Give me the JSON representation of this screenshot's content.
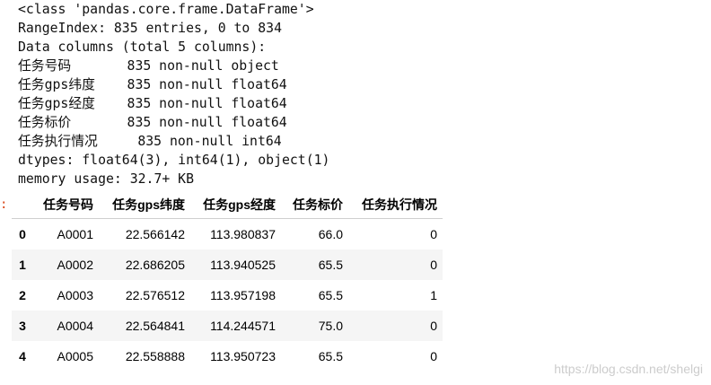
{
  "info_output": {
    "lines": [
      "<class 'pandas.core.frame.DataFrame'>",
      "RangeIndex: 835 entries, 0 to 834",
      "Data columns (total 5 columns):",
      "任务号码       835 non-null object",
      "任务gps纬度    835 non-null float64",
      "任务gps经度    835 non-null float64",
      "任务标价       835 non-null float64",
      "任务执行情况     835 non-null int64",
      "dtypes: float64(3), int64(1), object(1)",
      "memory usage: 32.7+ KB"
    ]
  },
  "out_prompt": ":",
  "dataframe": {
    "columns": [
      "任务号码",
      "任务gps纬度",
      "任务gps经度",
      "任务标价",
      "任务执行情况"
    ],
    "rows": [
      {
        "index": "0",
        "cells": [
          "A0001",
          "22.566142",
          "113.980837",
          "66.0",
          "0"
        ]
      },
      {
        "index": "1",
        "cells": [
          "A0002",
          "22.686205",
          "113.940525",
          "65.5",
          "0"
        ]
      },
      {
        "index": "2",
        "cells": [
          "A0003",
          "22.576512",
          "113.957198",
          "65.5",
          "1"
        ]
      },
      {
        "index": "3",
        "cells": [
          "A0004",
          "22.564841",
          "114.244571",
          "75.0",
          "0"
        ]
      },
      {
        "index": "4",
        "cells": [
          "A0005",
          "22.558888",
          "113.950723",
          "65.5",
          "0"
        ]
      }
    ]
  },
  "watermark": "https://blog.csdn.net/shelgi",
  "colors": {
    "prompt": "#d84315",
    "stripe": "#f5f5f5",
    "rule": "#cfcfcf",
    "watermark": "#cccccc",
    "text": "#111111"
  }
}
